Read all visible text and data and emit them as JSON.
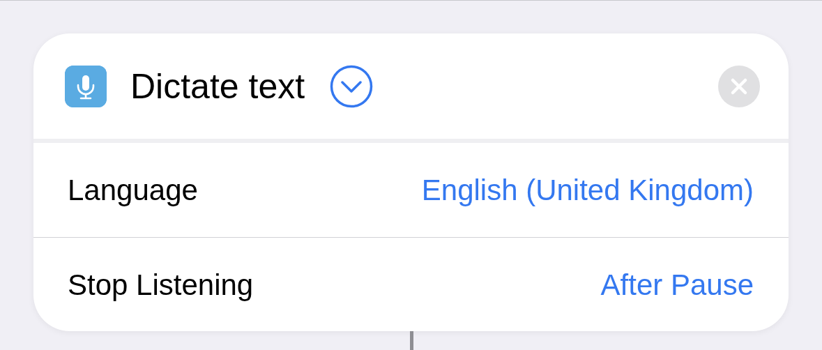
{
  "action": {
    "title": "Dictate text"
  },
  "parameters": [
    {
      "label": "Language",
      "value": "English (United Kingdom)"
    },
    {
      "label": "Stop Listening",
      "value": "After Pause"
    }
  ]
}
